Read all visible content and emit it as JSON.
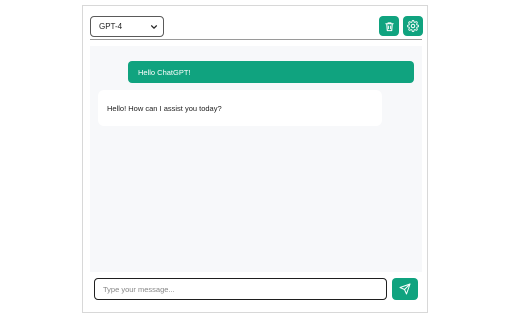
{
  "header": {
    "model_selected": "GPT-4",
    "model_options": [
      "GPT-4"
    ]
  },
  "messages": [
    {
      "role": "user",
      "text": "Hello ChatGPT!"
    },
    {
      "role": "assistant",
      "text": "Hello! How can I assist you today?"
    }
  ],
  "composer": {
    "placeholder": "Type your message...",
    "value": ""
  },
  "icons": {
    "delete": "trash-icon",
    "settings": "gear-icon",
    "send": "send-icon",
    "dropdown": "chevron-down-icon"
  },
  "colors": {
    "accent": "#10a37f",
    "chat_bg": "#f7f8fa",
    "bubble_bot_bg": "#ffffff"
  }
}
